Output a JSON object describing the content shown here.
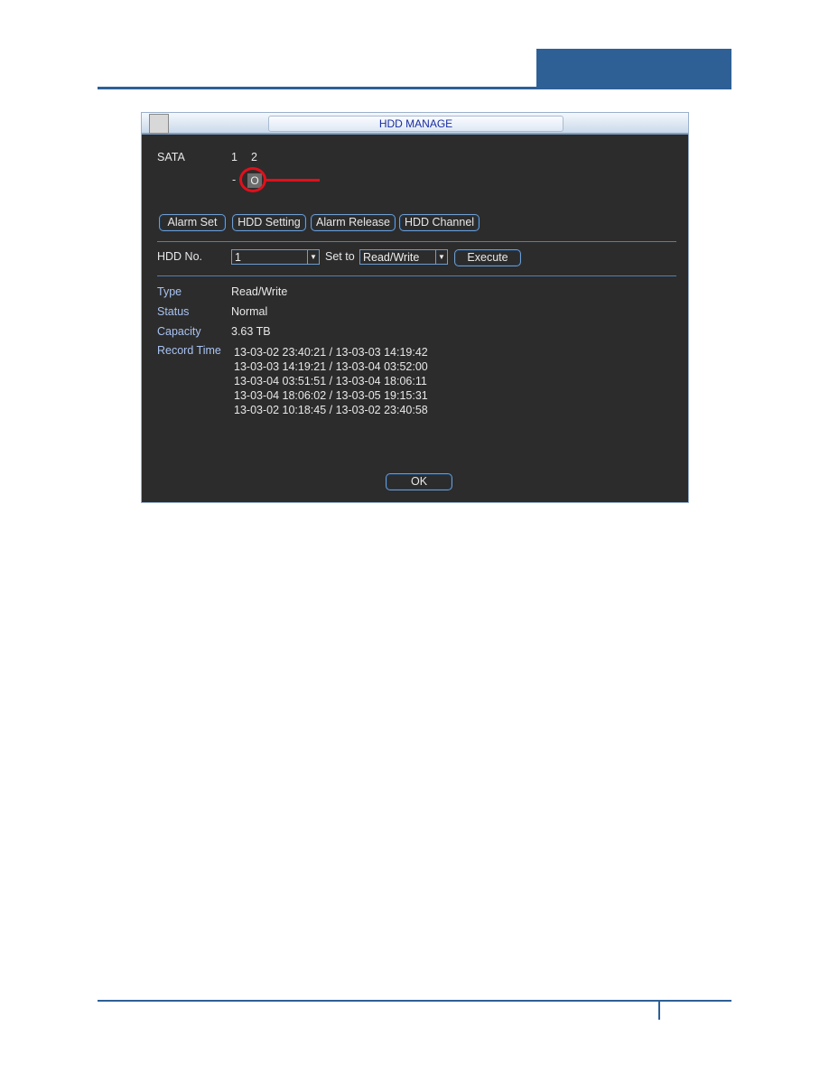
{
  "window": {
    "title": "HDD MANAGE"
  },
  "sata": {
    "label": "SATA",
    "ports": [
      "1",
      "2"
    ],
    "states": [
      "-",
      "O"
    ]
  },
  "buttons": {
    "alarm_set": "Alarm Set",
    "hdd_setting": "HDD Setting",
    "alarm_release": "Alarm Release",
    "hdd_channel": "HDD Channel",
    "execute": "Execute",
    "ok": "OK"
  },
  "controls": {
    "hdd_no_label": "HDD No.",
    "hdd_no_value": "1",
    "set_to_label": "Set to",
    "set_to_value": "Read/Write"
  },
  "info": {
    "type_label": "Type",
    "type_value": "Read/Write",
    "status_label": "Status",
    "status_value": "Normal",
    "capacity_label": "Capacity",
    "capacity_value": "3.63 TB",
    "record_label": "Record Time",
    "record_times": [
      "13-03-02 23:40:21 / 13-03-03 14:19:42",
      "13-03-03 14:19:21 / 13-03-04 03:52:00",
      "13-03-04 03:51:51 / 13-03-04 18:06:11",
      "13-03-04 18:06:02 / 13-03-05 19:15:31",
      "13-03-02 10:18:45 / 13-03-02 23:40:58"
    ]
  },
  "colors": {
    "brand": "#2e6096",
    "highlight": "#e0101c"
  }
}
